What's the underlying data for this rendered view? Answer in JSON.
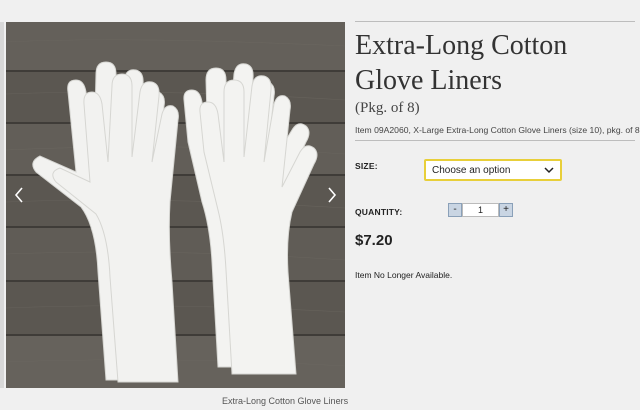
{
  "product": {
    "title": "Extra-Long Cotton Glove Liners",
    "subtitle": "(Pkg. of 8)",
    "item_line": "Item 09A2060, X-Large Extra-Long Cotton Glove Liners (size 10), pkg. of 8",
    "price": "$7.20",
    "availability": "Item No Longer Available."
  },
  "gallery": {
    "caption": "Extra-Long Cotton Glove Liners",
    "prev_icon": "chevron-left-icon",
    "next_icon": "chevron-right-icon"
  },
  "options": {
    "size_label": "SIZE:",
    "size_value": "Choose an option",
    "quantity_label": "QUANTITY:",
    "quantity_value": "1",
    "minus_label": "-",
    "plus_label": "+"
  },
  "colors": {
    "select_border": "#e8cf3a",
    "qty_button": "#c9d5e3",
    "wood": "#5e5a54",
    "glove": "#f4f4f2"
  }
}
